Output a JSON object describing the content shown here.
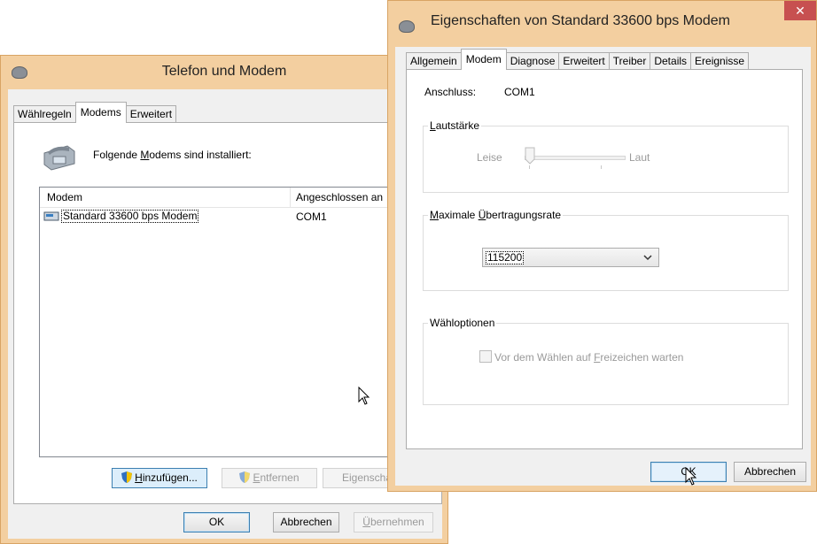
{
  "back_window": {
    "title": "Telefon und Modem",
    "tabs": [
      "Wählregeln",
      "Modems",
      "Erweitert"
    ],
    "installed_label": "Folgende Modems sind installiert:",
    "installed_label_ul": "M",
    "installed_label_pre": "Folgende ",
    "installed_label_post": "odems sind installiert:",
    "columns": [
      "Modem",
      "Angeschlossen an"
    ],
    "rows": [
      {
        "modem": "Standard 33600 bps Modem",
        "port": "COM1"
      }
    ],
    "buttons": {
      "add_ul": "H",
      "add_rest": "inzufügen...",
      "remove_ul": "E",
      "remove_rest": "ntfernen",
      "properties": "Eigenschaften",
      "ok": "OK",
      "cancel": "Abbrechen",
      "apply_ul": "Ü",
      "apply_rest": "bernehmen"
    }
  },
  "front_window": {
    "title": "Eigenschaften von Standard 33600 bps Modem",
    "tabs": [
      "Allgemein",
      "Modem",
      "Diagnose",
      "Erweitert",
      "Treiber",
      "Details",
      "Ereignisse"
    ],
    "port_label": "Anschluss:",
    "port_value": "COM1",
    "volume_group_ul": "L",
    "volume_group_rest": "autstärke",
    "volume_low": "Leise",
    "volume_high": "Laut",
    "volume_level": 0,
    "rate_group_ul": "M",
    "rate_group_mid": "aximale ",
    "rate_group_ul2": "Ü",
    "rate_group_rest": "bertragungsrate",
    "rate_value": "115200",
    "dial_group": "Wähloptionen",
    "dial_checkbox_pre": "Vor dem Wählen auf ",
    "dial_checkbox_ul": "F",
    "dial_checkbox_post": "reizeichen warten",
    "dial_checked": false,
    "ok": "OK",
    "cancel": "Abbrechen"
  },
  "colors": {
    "title_frame": "#f3cfa0",
    "close_button": "#c75050",
    "focus_blue": "#3c7fb1"
  },
  "icons": [
    "modem-app-icon",
    "telephone-icon",
    "modem-small-icon",
    "uac-shield-icon",
    "close-icon",
    "chevron-down-icon",
    "mouse-cursor-icon"
  ]
}
